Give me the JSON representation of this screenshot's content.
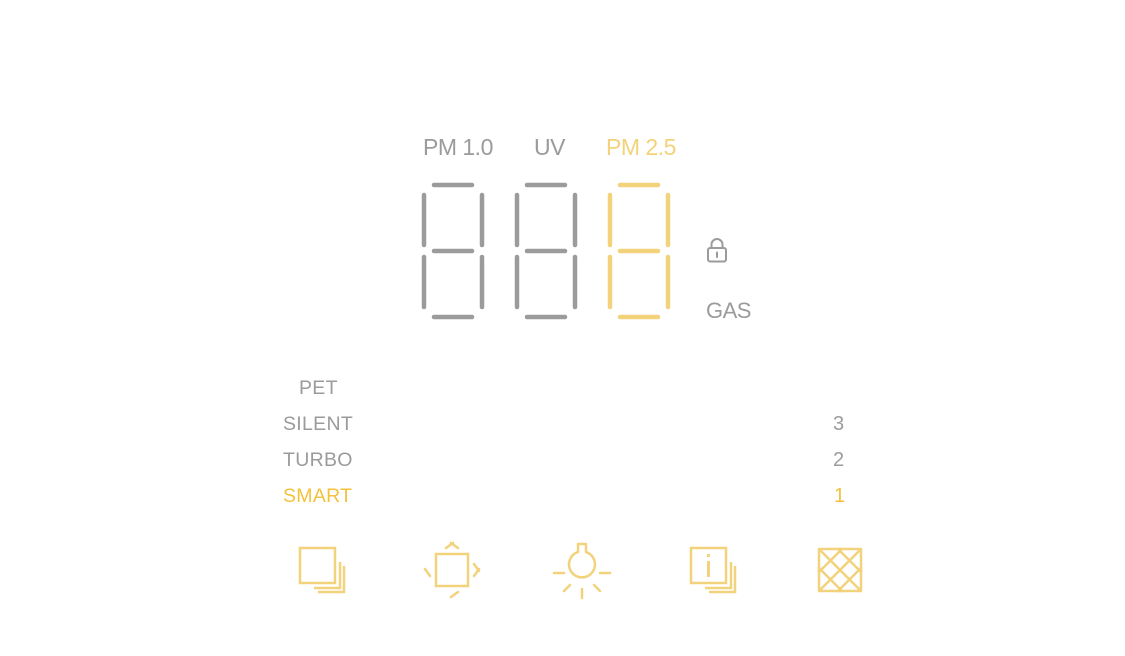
{
  "colors": {
    "inactive": "#9b9b9b",
    "active": "#f2d27a",
    "active_text": "#f3c23b",
    "background": "#ffffff"
  },
  "sensor_labels": {
    "pm10": "PM 1.0",
    "uv": "UV",
    "pm25": "PM 2.5",
    "active": "pm25"
  },
  "display": {
    "digits": [
      {
        "segments_on": [],
        "lit": false
      },
      {
        "segments_on": [],
        "lit": false
      },
      {
        "segments_on": [
          "b",
          "c"
        ],
        "lit": true
      }
    ]
  },
  "indicators": {
    "lock_icon": "lock-icon",
    "gas_label": "GAS"
  },
  "modes": [
    {
      "label": "PET",
      "active": false
    },
    {
      "label": "SILENT",
      "active": false
    },
    {
      "label": "TURBO",
      "active": false
    },
    {
      "label": "SMART",
      "active": true
    }
  ],
  "fan_levels": [
    {
      "label": "3",
      "active": false
    },
    {
      "label": "2",
      "active": false
    },
    {
      "label": "1",
      "active": true
    }
  ],
  "buttons": [
    {
      "name": "mode-button",
      "icon": "layers-icon"
    },
    {
      "name": "auto-cycle-button",
      "icon": "rotate-icon"
    },
    {
      "name": "light-button",
      "icon": "bulb-icon"
    },
    {
      "name": "info-button",
      "icon": "info-icon"
    },
    {
      "name": "fan-speed-button",
      "icon": "fan-icon"
    }
  ]
}
